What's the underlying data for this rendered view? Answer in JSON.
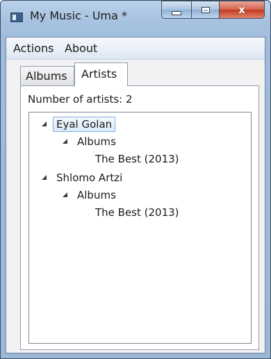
{
  "window": {
    "title": "My Music - Uma *",
    "close_glyph": "x"
  },
  "menu": {
    "items": [
      "Actions",
      "About"
    ]
  },
  "tabs": [
    {
      "label": "Albums",
      "selected": false
    },
    {
      "label": "Artists",
      "selected": true
    }
  ],
  "artists_panel": {
    "count_label": "Number of artists: 2",
    "tree": [
      {
        "artist": "Eyal Golan",
        "selected": true,
        "group_label": "Albums",
        "albums": [
          "The Best (2013)"
        ]
      },
      {
        "artist": "Shlomo Artzi",
        "selected": false,
        "group_label": "Albums",
        "albums": [
          "The Best (2013)"
        ]
      }
    ]
  },
  "icons": {
    "app": "window-app-icon",
    "minimize": "minimize-icon",
    "maximize": "maximize-icon",
    "close": "close-icon",
    "expander": "expanded-triangle-icon"
  },
  "colors": {
    "titlebar": "#a7c2e0",
    "close_button": "#c2391f",
    "selection_border": "#84acdd"
  }
}
